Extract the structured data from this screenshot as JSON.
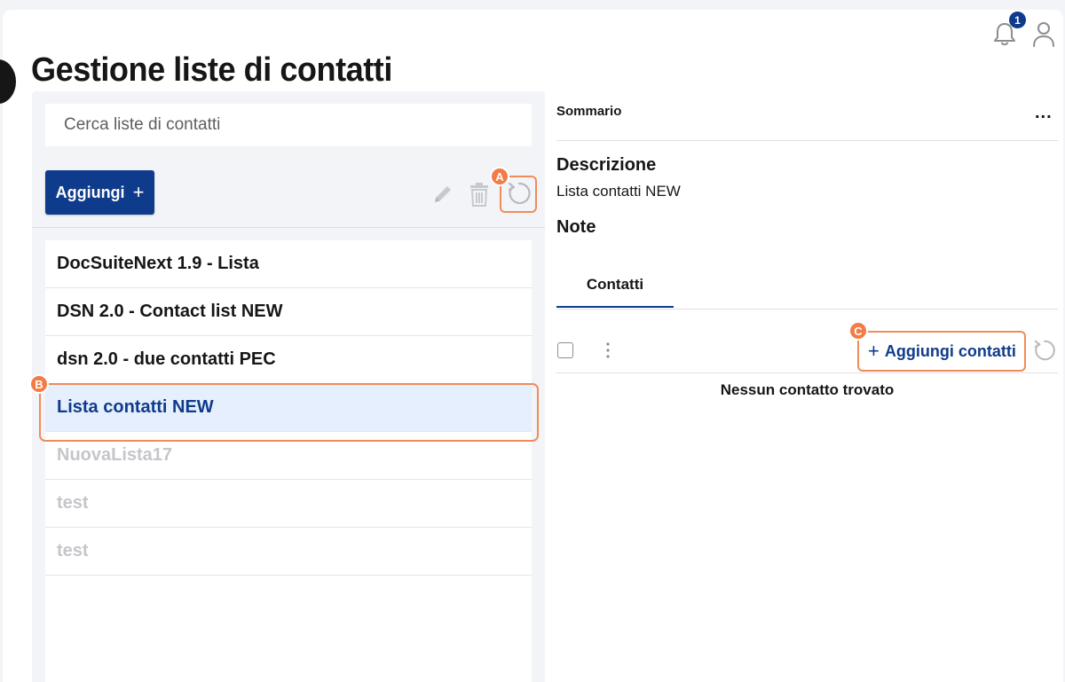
{
  "page": {
    "title": "Gestione liste di contatti"
  },
  "header": {
    "notification_count": "1"
  },
  "search": {
    "placeholder": "Cerca liste di contatti"
  },
  "toolbar": {
    "add_label": "Aggiungi",
    "add_icon": "+"
  },
  "lists": [
    {
      "label": "DocSuiteNext 1.9 - Lista",
      "state": "normal"
    },
    {
      "label": "DSN 2.0 - Contact list NEW",
      "state": "normal"
    },
    {
      "label": "dsn 2.0 - due contatti PEC",
      "state": "normal"
    },
    {
      "label": "Lista contatti NEW",
      "state": "selected"
    },
    {
      "label": "NuovaLista17",
      "state": "disabled"
    },
    {
      "label": "test",
      "state": "disabled"
    },
    {
      "label": "test",
      "state": "disabled"
    }
  ],
  "summary": {
    "title": "Sommario",
    "more": "...",
    "description_label": "Descrizione",
    "description_value": "Lista contatti NEW",
    "notes_label": "Note"
  },
  "tabs": [
    {
      "label": "Contatti"
    }
  ],
  "contacts": {
    "add_label": "Aggiungi contatti",
    "add_icon": "+",
    "empty_message": "Nessun contatto trovato"
  },
  "annotations": {
    "a": "A",
    "b": "B",
    "c": "C"
  },
  "colors": {
    "primary": "#0f3b8c",
    "highlight": "#f08c5a",
    "marker": "#f37c46",
    "selected_bg": "#e6effd",
    "disabled_text": "#c4c6ca"
  },
  "icons": [
    "bell-icon",
    "user-icon",
    "pencil-icon",
    "trash-icon",
    "refresh-icon",
    "kebab-icon",
    "plus-icon"
  ]
}
